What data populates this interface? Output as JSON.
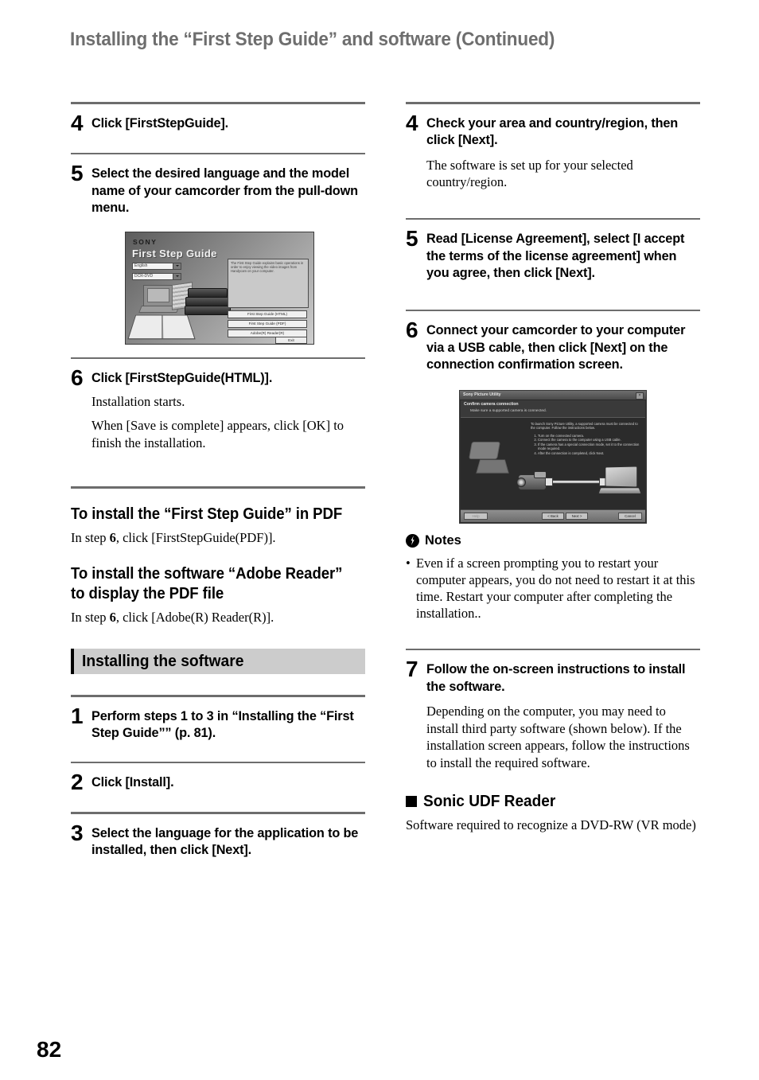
{
  "page": {
    "title": "Installing the “First Step Guide” and software (Continued)",
    "number": "82"
  },
  "left_column": {
    "step4": {
      "num": "4",
      "heading": "Click [FirstStepGuide]."
    },
    "step5": {
      "num": "5",
      "heading": "Select the desired language and the model name of your camcorder from the pull-down menu."
    },
    "step6": {
      "num": "6",
      "heading": "Click [FirstStepGuide(HTML)].",
      "text1": "Installation starts.",
      "text2": "When [Save is complete] appears, click [OK] to finish the installation."
    },
    "subsection_pdf": {
      "heading": "To install the “First Step Guide” in PDF",
      "body_prefix": "In step ",
      "body_step": "6",
      "body_suffix": ", click [FirstStepGuide(PDF)]."
    },
    "subsection_reader": {
      "heading": "To install the software “Adobe Reader” to display the PDF file",
      "body_prefix": "In step ",
      "body_step": "6",
      "body_suffix": ", click [Adobe(R) Reader(R)]."
    },
    "section_bar": {
      "label": "Installing the software"
    },
    "step1": {
      "num": "1",
      "heading": "Perform steps 1 to 3 in “Installing the “First Step Guide”” (p. 81)."
    },
    "step2": {
      "num": "2",
      "heading": "Click [Install]."
    },
    "step3": {
      "num": "3",
      "heading": "Select the language for the application to be installed, then click [Next]."
    }
  },
  "right_column": {
    "step4": {
      "num": "4",
      "heading": "Check your area and country/region, then click [Next].",
      "text": "The software is set up for your selected country/region."
    },
    "step5": {
      "num": "5",
      "heading": "Read [License Agreement], select [I accept the terms of the license agreement] when you agree, then click [Next]."
    },
    "step6": {
      "num": "6",
      "heading": "Connect your camcorder to your computer via a USB cable, then click [Next] on the connection confirmation screen."
    },
    "notes": {
      "icon": "bolt-badge-icon",
      "title": "Notes",
      "bullet": "•",
      "items": [
        "Even if a screen prompting you to restart your computer appears, you do not need to restart it at this time. Restart your computer after completing the installation.."
      ]
    },
    "step7": {
      "num": "7",
      "heading": "Follow the on-screen instructions to install the software.",
      "text": "Depending on the computer, you may need to install third party software (shown below). If the installation screen appears, follow the instructions to install the required software."
    },
    "sonic": {
      "marker": "black-square-icon",
      "heading": "Sonic UDF Reader",
      "text": "Software required to recognize a DVD-RW (VR mode)"
    }
  },
  "screenshot_first_step_guide": {
    "brand": "SONY",
    "title": "First Step Guide",
    "language_select": "English",
    "model_select": "DCR-DVD",
    "panel_text": "The First Step Guide explains basic operations in order to enjoy viewing the video images from Handycam on your computer.",
    "buttons": [
      "First Step Guide (HTML)",
      "First Step Guide (PDF)",
      "Adobe(R) Reader(R)"
    ],
    "exit_button": "Exit"
  },
  "screenshot_connection": {
    "window_title": "Sony Picture Utility",
    "header_line1": "Confirm camera connection",
    "header_line2": "Make sure a supported camera is connected.",
    "instructions_intro": "To launch Sony Picture Utility, a supported camera must be connected to the computer. Follow the instructions below.",
    "instructions_steps": [
      "Turn on the connected camera.",
      "Connect the camera to the computer using a USB cable.",
      "If the camera has a special connection mode, set it to the connection mode required.",
      "After the connection is completed, click Next."
    ],
    "buttons": {
      "help": "Help",
      "back": "< Back",
      "next": "Next >",
      "cancel": "Cancel"
    }
  },
  "colors": {
    "title_gray": "#6e6e6e",
    "rule_gray": "#6d6d6d",
    "section_bar_gray": "#cccccc",
    "accent_black": "#000000"
  }
}
